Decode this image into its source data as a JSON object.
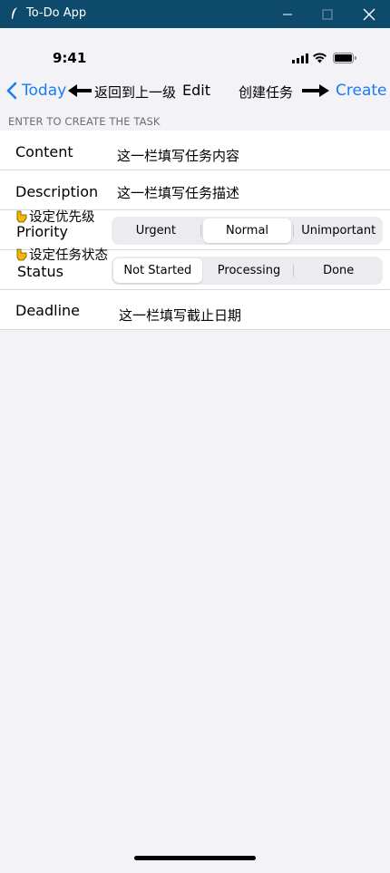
{
  "window": {
    "title": "To-Do App",
    "min_glyph": "—",
    "max_glyph": "☐",
    "close_glyph": "✕"
  },
  "status_bar": {
    "time": "9:41"
  },
  "nav": {
    "back_label": "Today",
    "back_note": "返回到上一级",
    "edit_label": "Edit",
    "create_note": "创建任务",
    "create_label": "Create"
  },
  "section": {
    "header": "ENTER TO CREATE THE TASK"
  },
  "form": {
    "content": {
      "label": "Content",
      "value": "这一栏填写任务内容"
    },
    "description": {
      "label": "Description",
      "value": "这一栏填写任务描述"
    },
    "priority": {
      "hint": "设定优先级",
      "label": "Priority",
      "options": [
        "Urgent",
        "Normal",
        "Unimportant"
      ],
      "selected": "Normal"
    },
    "status": {
      "hint": "设定任务状态",
      "label": "Status",
      "options": [
        "Not Started",
        "Processing",
        "Done"
      ],
      "selected": "Not Started"
    },
    "deadline": {
      "label": "Deadline",
      "value": "这一栏填写截止日期"
    }
  },
  "colors": {
    "accent": "#1a7cf0",
    "titlebar": "#0e4a6b",
    "background": "#f2f2f7"
  }
}
